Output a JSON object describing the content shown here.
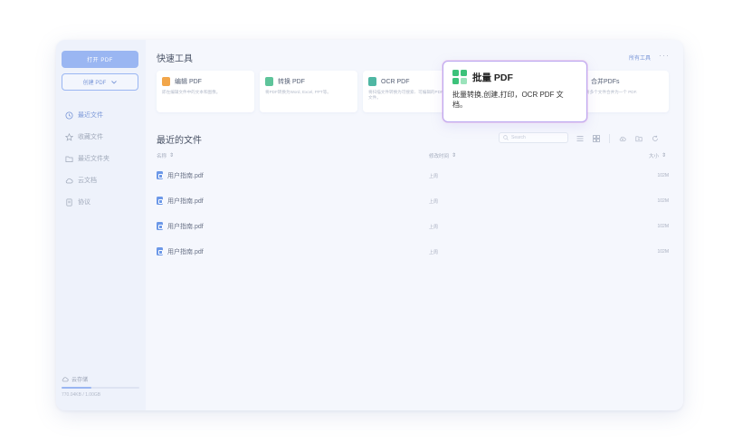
{
  "sidebar": {
    "open_label": "打开 PDF",
    "create_label": "创建 PDF",
    "items": [
      {
        "label": "最近文件",
        "icon": "clock-icon",
        "active": true
      },
      {
        "label": "收藏文件",
        "icon": "star-icon",
        "active": false
      },
      {
        "label": "最近文件夹",
        "icon": "folder-icon",
        "active": false
      },
      {
        "label": "云文档",
        "icon": "cloud-icon",
        "active": false
      },
      {
        "label": "协议",
        "icon": "document-icon",
        "active": false
      }
    ],
    "storage": {
      "label": "云存储",
      "used_text": "770.04KB / 1.00GB",
      "fill_fraction": 0.38
    }
  },
  "quick_tools": {
    "title": "快速工具",
    "all_tools_label": "所有工具",
    "more_label": "···",
    "cards": [
      {
        "name": "编辑 PDF",
        "desc": "即左编辑文件中的文本和图像。",
        "icon": "edit-pdf-icon",
        "color": "#f2a64a"
      },
      {
        "name": "转换 PDF",
        "desc": "将PDF转换为Word, Excel, PPT等。",
        "icon": "convert-pdf-icon",
        "color": "#5ec49a"
      },
      {
        "name": "OCR PDF",
        "desc": "将扫描文件转换为可搜索、可编辑的PDF文件。",
        "icon": "ocr-pdf-icon",
        "color": "#4fb7a3"
      },
      {
        "name": "合并PDFs",
        "desc": "将多个文件合并为一个 PDF.",
        "icon": "merge-pdf-icon",
        "color": "#7b98d8"
      }
    ]
  },
  "recent": {
    "title": "最近的文件",
    "search_placeholder": "Search",
    "columns": {
      "name": "名称",
      "modified": "修改时间",
      "size": "大小"
    },
    "sort_arrows": "⇕",
    "rows": [
      {
        "name": "用户指南.pdf",
        "modified": "上周",
        "size": "102M"
      },
      {
        "name": "用户指南.pdf",
        "modified": "上周",
        "size": "102M"
      },
      {
        "name": "用户指南.pdf",
        "modified": "上周",
        "size": "102M"
      },
      {
        "name": "用户指南.pdf",
        "modified": "上周",
        "size": "102M"
      }
    ]
  },
  "tooltip": {
    "title": "批量 PDF",
    "desc": "批量转换,创建,打印，OCR PDF 文档。",
    "icon": "batch-pdf-icon",
    "colors": [
      "#3cc27a",
      "#3cc27a",
      "#3cc27a",
      "#9be3bb"
    ]
  }
}
